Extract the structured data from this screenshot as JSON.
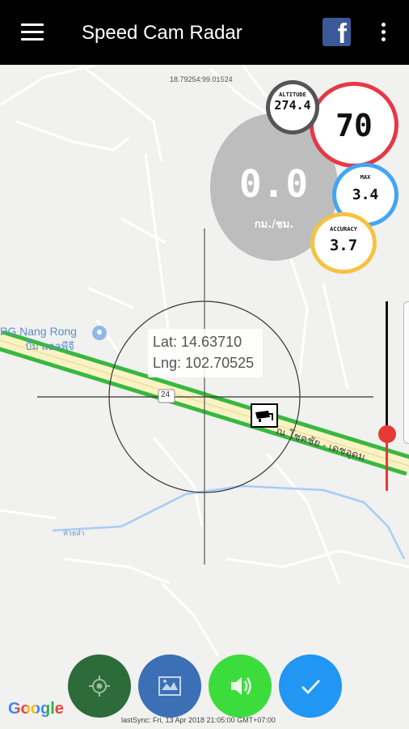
{
  "app": {
    "title": "Speed Cam Radar"
  },
  "toolbar": {
    "menu_icon": "hamburger-menu-icon",
    "facebook_icon": "facebook-icon",
    "facebook_glyph": "f",
    "overflow_icon": "more-vert-icon"
  },
  "map": {
    "top_coordinate": "18.79254:99.01524",
    "place_name": "PG Nang Rong",
    "place_name_thai": "ปั๊ม แอลพีจี",
    "road_number": "24",
    "road_name_thai": "ณ โชคชัย - เดชอุดม",
    "river_label": "ห้วยลำ",
    "latitude_text": "Lat: 14.63710",
    "longitude_text": "Lng: 102.70525",
    "camera_icon": "speed-camera-icon",
    "place_icon": "place-pin-icon"
  },
  "gauges": {
    "speed": {
      "value": "0.0",
      "unit": "กม./ชม."
    },
    "limit": {
      "value": "70",
      "color": "#e53945"
    },
    "altitude": {
      "label": "ALTITUDE",
      "value": "274.4",
      "color": "#555555"
    },
    "max": {
      "label": "MAX",
      "value": "3.4",
      "color": "#42a5f5"
    },
    "accuracy": {
      "label": "ACCURACY",
      "value": "3.7",
      "color": "#f5c242"
    }
  },
  "slider": {
    "level_percent": 30
  },
  "fabs": [
    {
      "name": "locate",
      "icon": "gps-crosshair-icon",
      "color": "#2e6b3a"
    },
    {
      "name": "map-type",
      "icon": "map-layers-icon",
      "color": "#3b6fb6"
    },
    {
      "name": "sound",
      "icon": "speaker-volume-icon",
      "color": "#3ddc3d"
    },
    {
      "name": "confirm",
      "icon": "checkmark-icon",
      "color": "#2196f3"
    }
  ],
  "footer": {
    "google_logo": "Google",
    "last_sync": "lastSync: Fri, 13 Apr 2018 21:05:00 GMT+07:00"
  }
}
